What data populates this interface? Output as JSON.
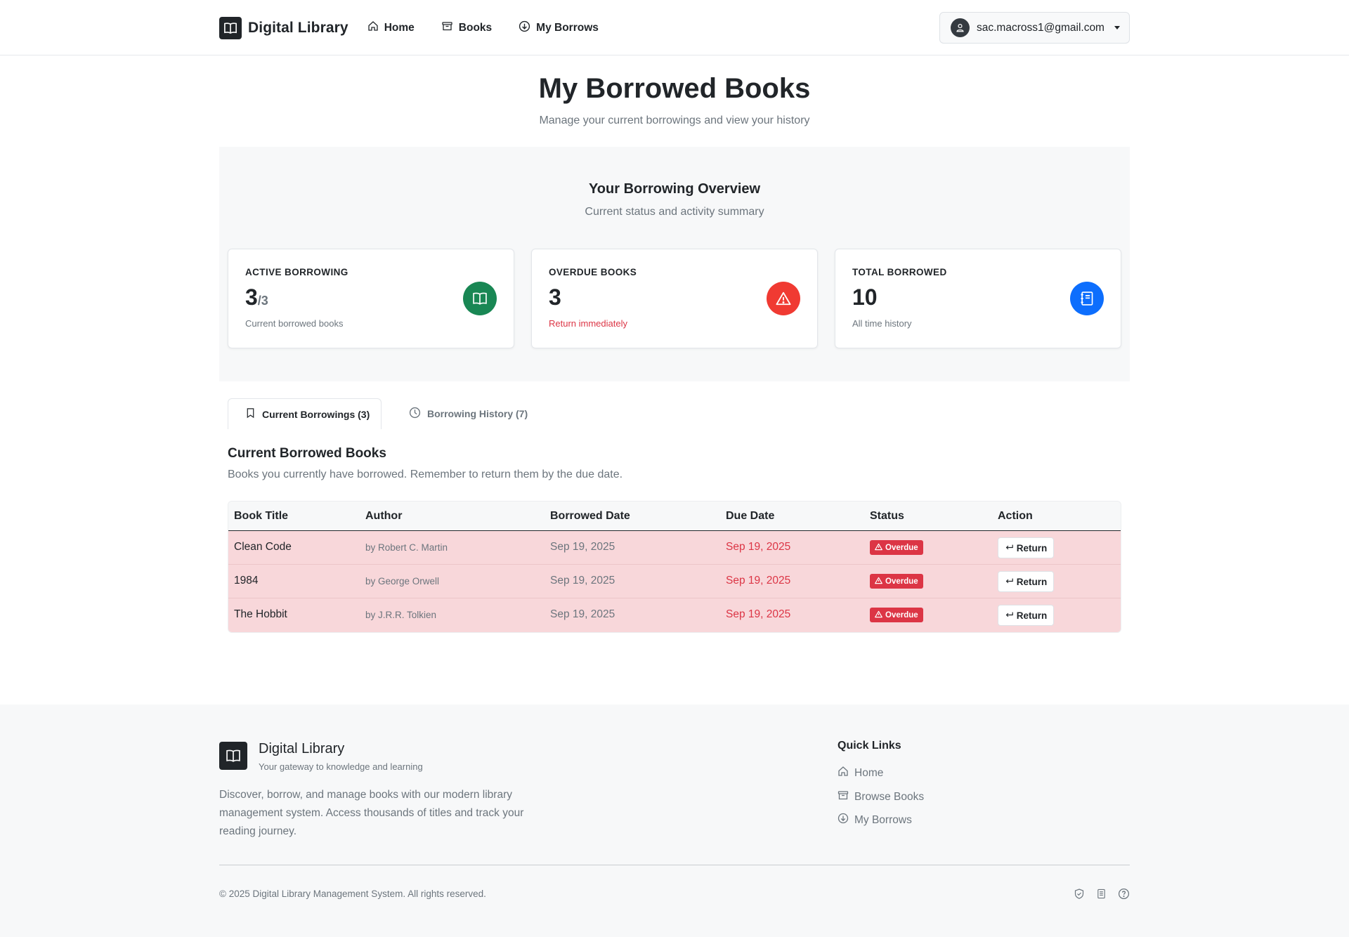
{
  "navbar": {
    "brand": "Digital Library",
    "links": [
      {
        "label": "Home",
        "icon": "house-icon"
      },
      {
        "label": "Books",
        "icon": "archive-icon"
      },
      {
        "label": "My Borrows",
        "icon": "download-circle-icon"
      }
    ],
    "user_email": "sac.macross1@gmail.com"
  },
  "header": {
    "title": "My Borrowed Books",
    "subtitle": "Manage your current borrowings and view your history"
  },
  "overview": {
    "title": "Your Borrowing Overview",
    "subtitle": "Current status and activity summary",
    "cards": [
      {
        "label": "ACTIVE BORROWING",
        "value": "3",
        "of": "/3",
        "caption": "Current borrowed books",
        "icon": "book-open-icon",
        "color": "#198754"
      },
      {
        "label": "OVERDUE BOOKS",
        "value": "3",
        "caption": "Return immediately",
        "icon": "warning-triangle-icon",
        "color": "#f03a32"
      },
      {
        "label": "TOTAL BORROWED",
        "value": "10",
        "caption": "All time history",
        "icon": "journal-icon",
        "color": "#0d6efd"
      }
    ]
  },
  "tabs": {
    "current": "Current Borrowings (3)",
    "history": "Borrowing History (7)"
  },
  "section": {
    "title": "Current Borrowed Books",
    "description": "Books you currently have borrowed. Remember to return them by the due date."
  },
  "table": {
    "headers": [
      "Book Title",
      "Author",
      "Borrowed Date",
      "Due Date",
      "Status",
      "Action"
    ],
    "rows": [
      {
        "title": "Clean Code",
        "author": "by Robert C. Martin",
        "borrowed": "Sep 19, 2025",
        "due": "Sep 19, 2025",
        "status": "Overdue",
        "action": "Return"
      },
      {
        "title": "1984",
        "author": "by George Orwell",
        "borrowed": "Sep 19, 2025",
        "due": "Sep 19, 2025",
        "status": "Overdue",
        "action": "Return"
      },
      {
        "title": "The Hobbit",
        "author": "by J.R.R. Tolkien",
        "borrowed": "Sep 19, 2025",
        "due": "Sep 19, 2025",
        "status": "Overdue",
        "action": "Return"
      }
    ]
  },
  "footer": {
    "brand": "Digital Library",
    "tagline": "Your gateway to knowledge and learning",
    "description": "Discover, borrow, and manage books with our modern library management system. Access thousands of titles and track your reading journey.",
    "quick_links_title": "Quick Links",
    "quick_links": [
      {
        "label": "Home",
        "icon": "house-icon"
      },
      {
        "label": "Browse Books",
        "icon": "archive-icon"
      },
      {
        "label": "My Borrows",
        "icon": "download-circle-icon"
      }
    ],
    "copyright": "© 2025 Digital Library Management System. All rights reserved.",
    "bottom_icons": [
      "shield-check-icon",
      "document-icon",
      "question-circle-icon"
    ]
  }
}
